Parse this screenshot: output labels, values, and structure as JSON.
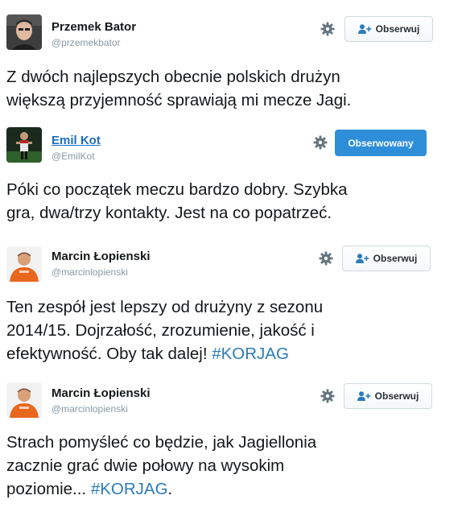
{
  "colors": {
    "hashtag": "#2b7bb9",
    "following_button": "#2e8ed8",
    "handle_gray": "#8899a6",
    "link_blue": "#1b6fbf"
  },
  "tweets": [
    {
      "name": "Przemek Bator",
      "handle": "@przemekbator",
      "follow_label": "Obserwuj",
      "follow_state": "not-following",
      "icons": [
        "settings-gear-icon",
        "follow-person-plus-icon"
      ],
      "text_lines": [
        "Z dwóch najlepszych obecnie polskich drużyn",
        "większą przyjemność sprawiają mi mecze Jagi."
      ]
    },
    {
      "name": "Emil Kot",
      "handle": "@EmilKot",
      "follow_label": "Obserwowany",
      "follow_state": "following",
      "icons": [
        "settings-gear-icon"
      ],
      "text_lines": [
        "Póki co początek meczu bardzo dobry. Szybka",
        "gra, dwa/trzy kontakty. Jest na co popatrzeć."
      ]
    },
    {
      "name": "Marcin Łopienski",
      "handle": "@marcinlopienski",
      "follow_label": "Obserwuj",
      "follow_state": "not-following",
      "icons": [
        "settings-gear-icon",
        "follow-person-plus-icon"
      ],
      "text_lines": [
        "Ten zespół jest lepszy od drużyny z sezonu",
        "2014/15. Dojrzałość, zrozumienie, jakość i"
      ],
      "last_line_prefix": "efektywność. Oby tak dalej! ",
      "last_line_hashtag": "#KORJAG"
    },
    {
      "name": "Marcin Łopienski",
      "handle": "@marcinlopienski",
      "follow_label": "Obserwuj",
      "follow_state": "not-following",
      "icons": [
        "settings-gear-icon",
        "follow-person-plus-icon"
      ],
      "text_lines": [
        "Strach pomyśleć co będzie, jak Jagiellonia",
        "zacznie grać dwie połowy na wysokim"
      ],
      "last_line_prefix": "poziomie... ",
      "last_line_hashtag": "#KORJAG",
      "last_line_suffix": "."
    }
  ]
}
